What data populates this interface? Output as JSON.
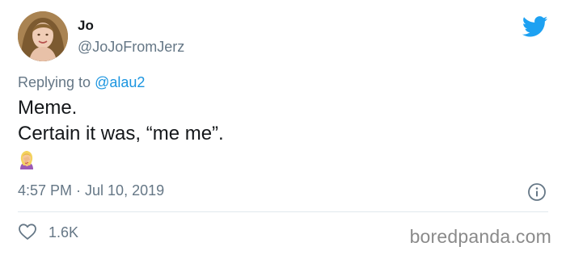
{
  "user": {
    "name": "Jo",
    "handle": "@JoJoFromJerz",
    "avatar_icon": "profile-photo"
  },
  "reply": {
    "prefix": "Replying to ",
    "mention": "@alau2"
  },
  "tweet": {
    "lines": [
      "Meme.",
      "Certain it was, “me me”."
    ],
    "emoji": "woman-facepalming"
  },
  "meta": {
    "timestamp": "4:57 PM · Jul 10, 2019"
  },
  "actions": {
    "likes": "1.6K"
  },
  "watermark": "boredpanda.com",
  "colors": {
    "twitter_blue": "#1da1f2",
    "secondary_text": "#657786",
    "mention": "#1b95e0",
    "divider": "#e1e8ed"
  }
}
